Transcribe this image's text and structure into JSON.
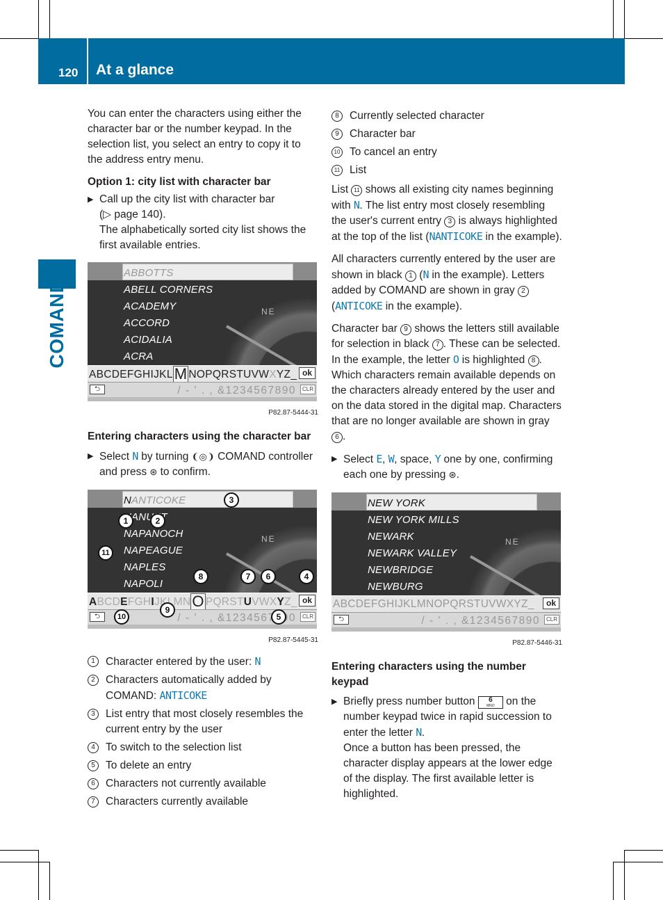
{
  "header": {
    "page_number": "120",
    "section_title": "At a glance",
    "side_tab_label": "COMAND",
    "brand_color": "#006c9f",
    "highlight_color": "#1079b0"
  },
  "left": {
    "intro": "You can enter the characters using either the character bar or the number keypad. In the selection list, you select an entry to copy it to the address entry menu.",
    "option1_heading": "Option 1: city list with character bar",
    "step1_text": "Call up the city list with character bar",
    "step1_ref": "(▷ page 140).",
    "step1_note": "The alphabetically sorted city list shows the first available entries.",
    "figure1": {
      "cities": [
        "ABBOTTS",
        "ABELL CORNERS",
        "ACADEMY",
        "ACCORD",
        "ACIDALIA",
        "ACRA"
      ],
      "charbar_before": "ABCDEFGHIJKL",
      "charbar_selected": "M",
      "charbar_after": "NOPQRSTUVW",
      "charbar_gray": "X",
      "charbar_end": "YZ_",
      "ok_label": "ok",
      "back_icon": "⮌",
      "numbers": "/ - ' . , &1234567890",
      "clr_label": "CLR",
      "compass_label": "NE",
      "code": "P82.87-5444-31"
    },
    "entering_heading": "Entering characters using the character bar",
    "step2_pre": "Select",
    "step2_letter": "N",
    "step2_mid": "by turning",
    "step2_controller_icon": "❨◎❩",
    "step2_mid2": "COMAND controller and press",
    "step2_press_icon": "⊛",
    "step2_post": "to confirm.",
    "figure2": {
      "cities": [
        "NANTICOKE",
        "NANUET",
        "NAPANOCH",
        "NAPEAGUE",
        "NAPLES",
        "NAPOLI"
      ],
      "first_user_char": "N",
      "first_auto_chars": "ANTICOKE",
      "charbar": [
        {
          "c": "A",
          "avail": true
        },
        {
          "c": "B",
          "avail": false
        },
        {
          "c": "C",
          "avail": false
        },
        {
          "c": "D",
          "avail": false
        },
        {
          "c": "E",
          "avail": true
        },
        {
          "c": "F",
          "avail": false
        },
        {
          "c": "G",
          "avail": false
        },
        {
          "c": "H",
          "avail": false
        },
        {
          "c": "I",
          "avail": true
        },
        {
          "c": "J",
          "avail": false
        },
        {
          "c": "K",
          "avail": false
        },
        {
          "c": "L",
          "avail": false
        },
        {
          "c": "M",
          "avail": false
        },
        {
          "c": "N",
          "avail": false
        },
        {
          "c": "O",
          "avail": true,
          "selected": true
        },
        {
          "c": "P",
          "avail": false
        },
        {
          "c": "Q",
          "avail": false
        },
        {
          "c": "R",
          "avail": false
        },
        {
          "c": "S",
          "avail": false
        },
        {
          "c": "T",
          "avail": false
        },
        {
          "c": "U",
          "avail": true
        },
        {
          "c": "V",
          "avail": false
        },
        {
          "c": "W",
          "avail": false
        },
        {
          "c": "X",
          "avail": false
        },
        {
          "c": "Y",
          "avail": true
        },
        {
          "c": "Z",
          "avail": false
        },
        {
          "c": "_",
          "avail": false
        }
      ],
      "ok_label": "ok",
      "numbers": "/ - ' . , &1234567890",
      "clr_label": "CLR",
      "compass_label": "NE",
      "callouts": [
        "1",
        "2",
        "3",
        "4",
        "5",
        "6",
        "7",
        "8",
        "9",
        "10",
        "11"
      ],
      "code": "P82.87-5445-31"
    },
    "legend": [
      {
        "num": "1",
        "text": "Character entered by the user:",
        "hl": "N"
      },
      {
        "num": "2",
        "text": "Characters automatically added by COMAND:",
        "hl": "ANTICOKE"
      },
      {
        "num": "3",
        "text": "List entry that most closely resembles the current entry by the user"
      },
      {
        "num": "4",
        "text": "To switch to the selection list"
      },
      {
        "num": "5",
        "text": "To delete an entry"
      },
      {
        "num": "6",
        "text": "Characters not currently available"
      },
      {
        "num": "7",
        "text": "Characters currently available"
      }
    ]
  },
  "right": {
    "legend": [
      {
        "num": "8",
        "text": "Currently selected character"
      },
      {
        "num": "9",
        "text": "Character bar"
      },
      {
        "num": "10",
        "text": "To cancel an entry"
      },
      {
        "num": "11",
        "text": "List"
      }
    ],
    "para1": {
      "a": "List",
      "circ1": "11",
      "b": "shows all existing city names beginning with",
      "hl1": "N",
      "c": ". The list entry most closely resembling the user's current entry",
      "circ2": "3",
      "d": "is always highlighted at the top of the list (",
      "hl2": "NANTICOKE",
      "e": "in the example)."
    },
    "para2": {
      "a": "All characters currently entered by the user are shown in black",
      "circ1": "1",
      "b": "(",
      "hl1": "N",
      "c": "in the example). Letters added by COMAND are shown in gray",
      "circ2": "2",
      "d": "(",
      "hl2": "ANTICOKE",
      "e": "in the example)."
    },
    "para3": {
      "a": "Character bar",
      "circ1": "9",
      "b": "shows the letters still available for selection in black",
      "circ2": "7",
      "c": ". These can be selected. In the example, the letter",
      "hl1": "O",
      "d": "is highlighted",
      "circ3": "8",
      "e": ". Which characters remain available depends on the characters already entered by the user and on the data stored in the digital map. Characters that are no longer available are shown in gray",
      "circ4": "6",
      "f": "."
    },
    "step3": {
      "a": "Select",
      "hl1": "E",
      "b": ",",
      "hl2": "W",
      "c": ", space,",
      "hl3": "Y",
      "d": "one by one, confirming each one by pressing",
      "icon": "⊛",
      "e": "."
    },
    "figure3": {
      "cities": [
        "NEW YORK",
        "NEW YORK MILLS",
        "NEWARK",
        "NEWARK VALLEY",
        "NEWBRIDGE",
        "NEWBURG"
      ],
      "charbar": "ABCDEFGHIJKLMNOPQRSTUVWXYZ_",
      "ok_label": "ok",
      "numbers": "/ - ' . , &1234567890",
      "clr_label": "CLR",
      "compass_label": "NE",
      "code": "P82.87-5446-31"
    },
    "keypad_heading": "Entering characters using the number keypad",
    "step4": {
      "a": "Briefly press number button",
      "key_num": "6",
      "key_letters": "MNO",
      "b": "on the number keypad twice in rapid succession to enter the letter",
      "hl": "N",
      "c": ".",
      "note": "Once a button has been pressed, the character display appears at the lower edge of the display. The first available letter is highlighted."
    }
  }
}
